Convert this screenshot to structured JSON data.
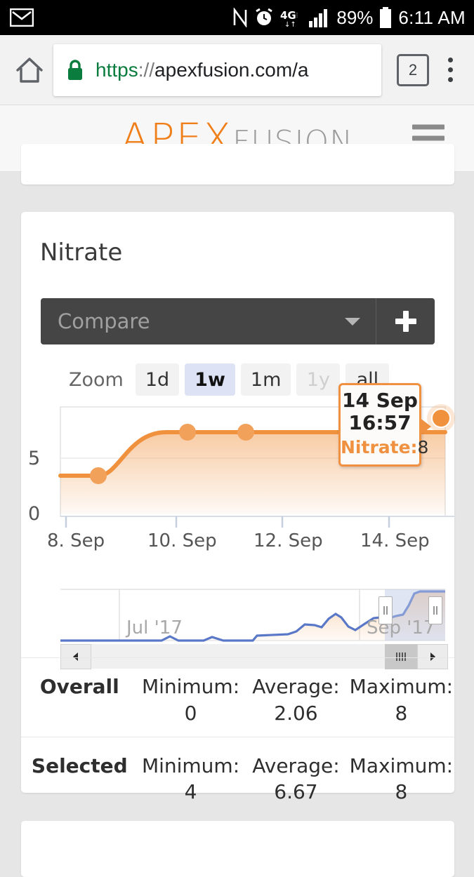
{
  "status_bar": {
    "left_icon": "mail-icon",
    "icons": [
      "nfc-icon",
      "alarm-icon",
      "4g-lte-icon",
      "signal-bars-icon"
    ],
    "battery_percent": "89%",
    "time": "6:11 AM"
  },
  "browser": {
    "home_icon": "home-icon",
    "lock_icon": "lock-icon",
    "url_scheme": "https",
    "url_separator": "://",
    "url_host_path": "apexfusion.com/a",
    "tab_count": "2",
    "menu_icon": "overflow-menu-icon"
  },
  "site_header": {
    "logo_primary": "APEX",
    "logo_secondary": "FUSION",
    "menu_icon": "hamburger-icon"
  },
  "card": {
    "title": "Nitrate",
    "compare": {
      "placeholder": "Compare",
      "add_label": "+"
    },
    "range_selector": {
      "label": "Zoom",
      "buttons": [
        {
          "label": "1d",
          "state": "normal"
        },
        {
          "label": "1w",
          "state": "selected"
        },
        {
          "label": "1m",
          "state": "normal"
        },
        {
          "label": "1y",
          "state": "disabled"
        },
        {
          "label": "all",
          "state": "normal"
        }
      ]
    },
    "tooltip": {
      "date": "14 Sep",
      "time": "16:57",
      "series_label": "Nitrate:",
      "value": "8"
    },
    "navigator": {
      "left_label": "Jul '17",
      "right_label": "Sep '17",
      "scroll_left_icon": "scroll-left-arrow-icon",
      "scroll_right_icon": "scroll-right-arrow-icon",
      "thumb_grip_icon": "scrollbar-grip-icon",
      "handle_grip_icon": "range-handle-grip-icon"
    },
    "stats": {
      "rows": [
        {
          "label": "Overall",
          "minimum": "Minimum: 0",
          "average": "Average: 2.06",
          "maximum": "Maximum: 8"
        },
        {
          "label": "Selected",
          "minimum": "Minimum: 4",
          "average": "Average: 6.67",
          "maximum": "Maximum: 8"
        }
      ]
    }
  },
  "colors": {
    "accent_orange": "#f0913e",
    "logo_orange": "#f07f1a",
    "navigator_blue": "#5a78c8",
    "selection_blue": "#b9c6e4",
    "compare_bar": "#454545",
    "selected_range_btn": "#dde3f5"
  },
  "chart_data": {
    "type": "area",
    "title": "Nitrate",
    "series_name": "Nitrate",
    "xlabel": "",
    "ylabel": "",
    "ylim": [
      0,
      9
    ],
    "yticks": [
      0,
      5
    ],
    "ytick_labels": [
      "0",
      "5"
    ],
    "xtick_labels": [
      "8. Sep",
      "10. Sep",
      "12. Sep",
      "14. Sep"
    ],
    "grid": true,
    "legend": false,
    "x": [
      "8. Sep",
      "8. Sep 12:00",
      "9. Sep",
      "9. Sep 12:00",
      "10. Sep",
      "11. Sep",
      "12. Sep",
      "13. Sep",
      "14. Sep 16:57"
    ],
    "values": [
      4,
      4,
      4,
      6,
      8,
      8,
      8,
      8,
      8
    ],
    "markers": [
      {
        "x": "8. Sep 12:00",
        "y": 4
      },
      {
        "x": "10. Sep",
        "y": 8
      },
      {
        "x": "12. Sep",
        "y": 8
      },
      {
        "x": "14. Sep 16:57",
        "y": 8,
        "hovered": true
      }
    ],
    "navigator": {
      "type": "line",
      "xtick_labels": [
        "Jul '17",
        "Sep '17"
      ],
      "selection": {
        "from": "Sep '17",
        "to": "end"
      }
    },
    "stats": {
      "overall": {
        "minimum": 0,
        "average": 2.06,
        "maximum": 8
      },
      "selected": {
        "minimum": 4,
        "average": 6.67,
        "maximum": 8
      }
    }
  }
}
